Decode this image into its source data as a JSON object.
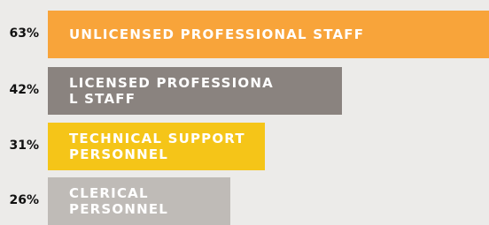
{
  "chart_data": {
    "type": "bar",
    "orientation": "horizontal",
    "categories": [
      "UNLICENSED PROFESSIONAL STAFF",
      "LICENSED PROFESSIONAL STAFF",
      "TECHNICAL SUPPORT PERSONNEL",
      "CLERICAL PERSONNEL"
    ],
    "values": [
      63,
      42,
      31,
      26
    ],
    "value_labels": [
      "63%",
      "42%",
      "31%",
      "26%"
    ],
    "unit": "%",
    "colors": [
      "#f8a43a",
      "#8a837f",
      "#f5c518",
      "#bfbbb7"
    ],
    "background": "#ecebe9"
  }
}
